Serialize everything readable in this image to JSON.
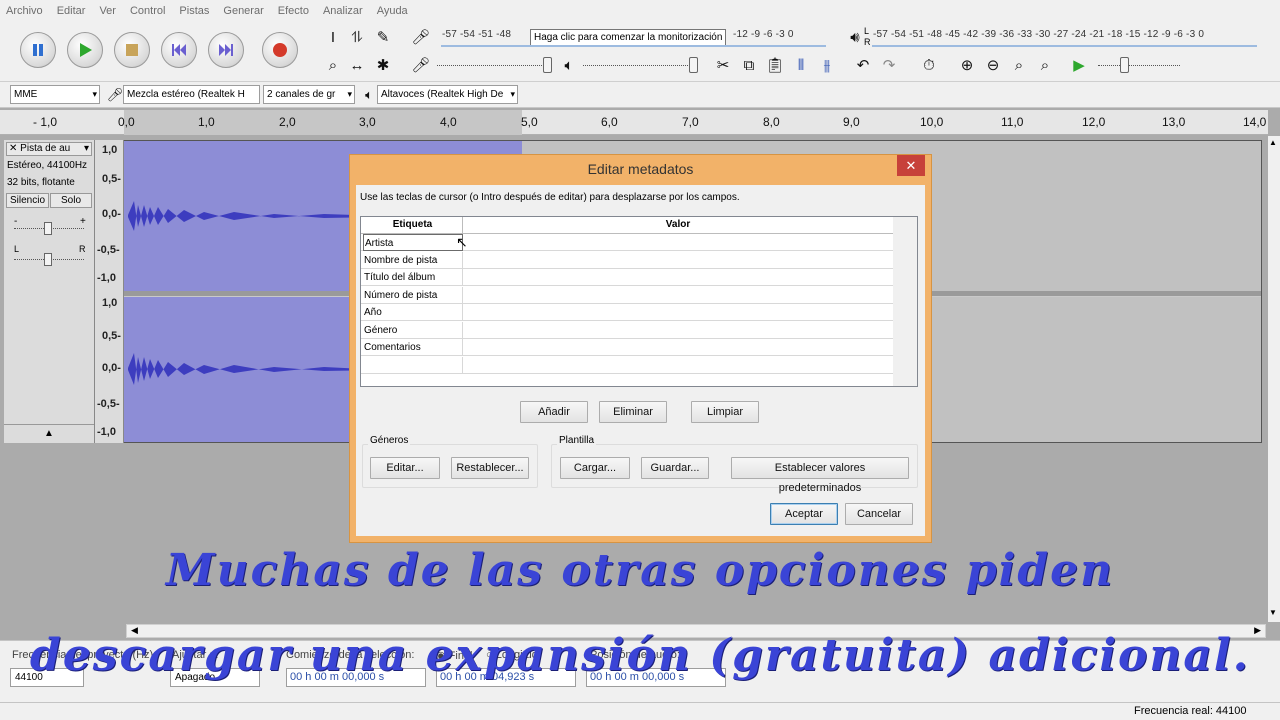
{
  "menu": [
    "Archivo",
    "Editar",
    "Ver",
    "Control",
    "Pistas",
    "Generar",
    "Efecto",
    "Analizar",
    "Ayuda"
  ],
  "transport": {
    "icons": [
      "pause-icon",
      "play-icon",
      "stop-icon",
      "skip-start-icon",
      "skip-end-icon",
      "record-icon"
    ]
  },
  "meters": {
    "record_scale": "-57 -54 -51 -48",
    "record_tooltip": "Haga clic para comenzar la monitorización",
    "record_scale_right": "-12  -9  -6  -3  0",
    "play_scale": "-57 -54 -51 -48 -45 -42 -39 -36 -33 -30 -27 -24 -21 -18 -15 -12  -9  -6  -3  0",
    "L": "L",
    "R": "R"
  },
  "devices": {
    "host": "MME",
    "recording_device": "Mezcla estéreo (Realtek H",
    "channels": "2 canales de gr",
    "playback_device": "Altavoces (Realtek High De"
  },
  "ruler": [
    "- 1,0",
    "0,0",
    "1,0",
    "2,0",
    "3,0",
    "4,0",
    "5,0",
    "6,0",
    "7,0",
    "8,0",
    "9,0",
    "10,0",
    "11,0",
    "12,0",
    "13,0",
    "14,0"
  ],
  "track": {
    "name": "Pista de au",
    "info1": "Estéreo, 44100Hz",
    "info2": "32 bits, flotante",
    "mute": "Silencio",
    "solo": "Solo",
    "gain_minus": "-",
    "gain_plus": "+",
    "pan_left": "L",
    "pan_right": "R"
  },
  "vruler": {
    "top": [
      "1,0",
      "0,5-",
      "0,0-",
      "-0,5-",
      "-1,0"
    ],
    "bottom": [
      "1,0",
      "0,5-",
      "0,0-",
      "-0,5-",
      "-1,0"
    ]
  },
  "dialog": {
    "title": "Editar metadatos",
    "close": "✕",
    "instructions": "Use las teclas de cursor (o Intro después de editar) para desplazarse por los campos.",
    "col_tag": "Etiqueta",
    "col_value": "Valor",
    "rows": [
      "Artista",
      "Nombre de pista",
      "Título del álbum",
      "Número de pista",
      "Año",
      "Género",
      "Comentarios"
    ],
    "add": "Añadir",
    "remove": "Eliminar",
    "clear": "Limpiar",
    "genres_label": "Géneros",
    "edit_genres": "Editar...",
    "reset_genres": "Restablecer...",
    "template_label": "Plantilla",
    "load": "Cargar...",
    "save": "Guardar...",
    "set_default": "Establecer valores predeterminados",
    "ok": "Aceptar",
    "cancel": "Cancelar"
  },
  "selection_bar": {
    "rate_label": "Frecuencia del proyecto (Hz):",
    "snap_label": "Ajustar a:",
    "start_label": "Comienzo de la selección:",
    "end_label": "Final",
    "length_label": "Longitud",
    "audio_pos_label": "Posición de audio:",
    "rate_value": "44100",
    "snap_value": "Apagado",
    "start_value": "00 h 00 m 00,000 s",
    "length_value": "00 h 00 m 04,923 s",
    "audio_pos_value": "00 h 00 m 00,000 s"
  },
  "status": {
    "actual_rate": "Frecuencia real: 44100"
  },
  "subtitle": {
    "line1": "Muchas de las otras opciones piden",
    "line2": "descargar una expansión (gratuita) adicional."
  },
  "colors": {
    "waveform": "#3d3dbf",
    "selection": "#8d8dd6",
    "dialog_frame": "#f2b269",
    "subtitle": "#3a44d6"
  }
}
